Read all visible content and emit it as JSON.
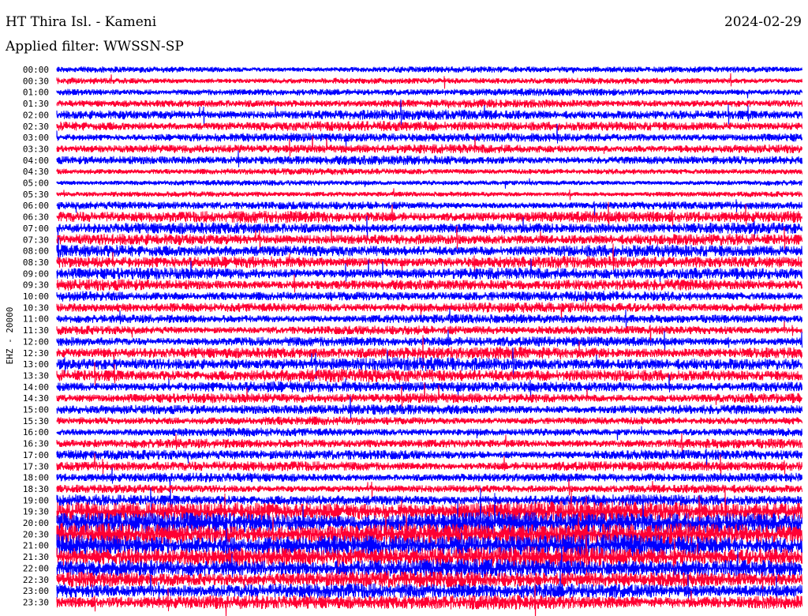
{
  "header": {
    "station": "HT Thira Isl. - Kameni",
    "date": "2024-02-29",
    "filter_label": "Applied filter: WWSSN-SP"
  },
  "chart_data": {
    "type": "line",
    "title": "HT Thira Isl. - Kameni",
    "ylabel": "EHZ - 20000",
    "xlabel": "",
    "colors": [
      "#0000ff",
      "#ff0033"
    ],
    "rows": [
      {
        "label": "00:00",
        "amp": 0.35
      },
      {
        "label": "00:30",
        "amp": 0.35
      },
      {
        "label": "01:00",
        "amp": 0.4
      },
      {
        "label": "01:30",
        "amp": 0.45
      },
      {
        "label": "02:00",
        "amp": 0.55
      },
      {
        "label": "02:30",
        "amp": 0.55
      },
      {
        "label": "03:00",
        "amp": 0.5
      },
      {
        "label": "03:30",
        "amp": 0.5
      },
      {
        "label": "04:00",
        "amp": 0.5
      },
      {
        "label": "04:30",
        "amp": 0.35
      },
      {
        "label": "05:00",
        "amp": 0.3
      },
      {
        "label": "05:30",
        "amp": 0.3
      },
      {
        "label": "06:00",
        "amp": 0.45
      },
      {
        "label": "06:30",
        "amp": 0.65
      },
      {
        "label": "07:00",
        "amp": 0.6
      },
      {
        "label": "07:30",
        "amp": 0.6
      },
      {
        "label": "08:00",
        "amp": 0.65
      },
      {
        "label": "08:30",
        "amp": 0.65
      },
      {
        "label": "09:00",
        "amp": 0.65
      },
      {
        "label": "09:30",
        "amp": 0.6
      },
      {
        "label": "10:00",
        "amp": 0.55
      },
      {
        "label": "10:30",
        "amp": 0.55
      },
      {
        "label": "11:00",
        "amp": 0.5
      },
      {
        "label": "11:30",
        "amp": 0.5
      },
      {
        "label": "12:00",
        "amp": 0.55
      },
      {
        "label": "12:30",
        "amp": 0.65
      },
      {
        "label": "13:00",
        "amp": 0.7
      },
      {
        "label": "13:30",
        "amp": 0.7
      },
      {
        "label": "14:00",
        "amp": 0.6
      },
      {
        "label": "14:30",
        "amp": 0.55
      },
      {
        "label": "15:00",
        "amp": 0.55
      },
      {
        "label": "15:30",
        "amp": 0.45
      },
      {
        "label": "16:00",
        "amp": 0.45
      },
      {
        "label": "16:30",
        "amp": 0.5
      },
      {
        "label": "17:00",
        "amp": 0.55
      },
      {
        "label": "17:30",
        "amp": 0.55
      },
      {
        "label": "18:00",
        "amp": 0.5
      },
      {
        "label": "18:30",
        "amp": 0.45
      },
      {
        "label": "19:00",
        "amp": 0.6
      },
      {
        "label": "19:30",
        "amp": 1.1
      },
      {
        "label": "20:00",
        "amp": 1.2
      },
      {
        "label": "20:30",
        "amp": 1.2
      },
      {
        "label": "21:00",
        "amp": 1.2
      },
      {
        "label": "21:30",
        "amp": 1.1
      },
      {
        "label": "22:00",
        "amp": 1.0
      },
      {
        "label": "22:30",
        "amp": 0.9
      },
      {
        "label": "23:00",
        "amp": 0.85
      },
      {
        "label": "23:30",
        "amp": 0.8
      }
    ]
  }
}
